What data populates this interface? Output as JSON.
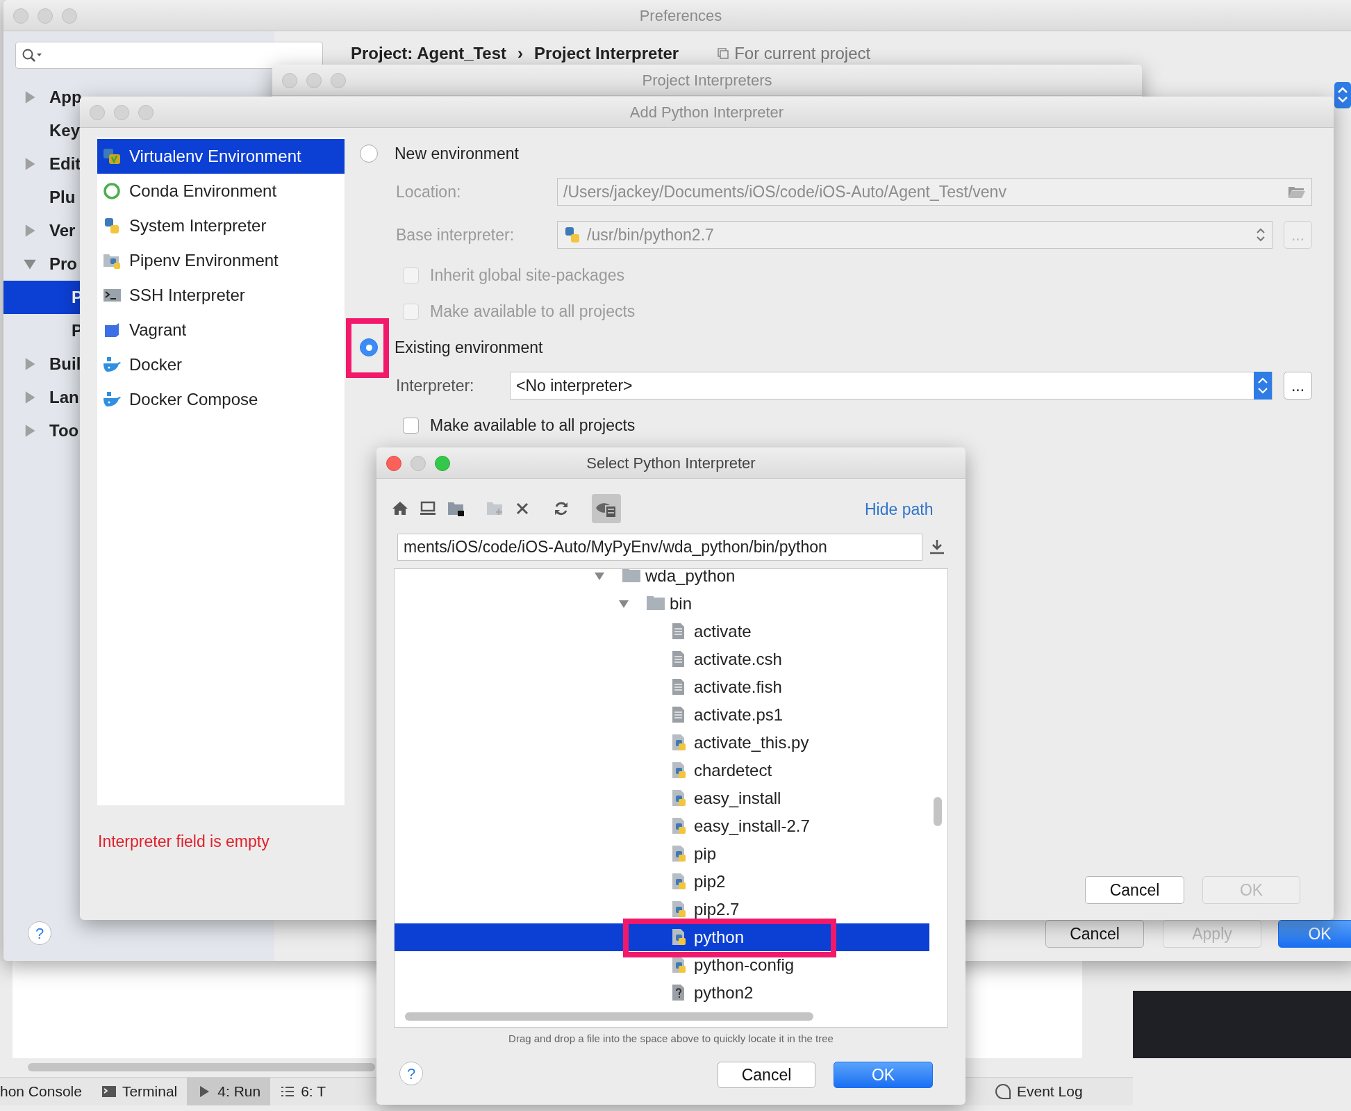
{
  "preferences": {
    "title": "Preferences",
    "sidebar": [
      {
        "label": "App",
        "expanded": false,
        "selected": false
      },
      {
        "label": "Key",
        "selected": false
      },
      {
        "label": "Edit",
        "expanded": false,
        "selected": false
      },
      {
        "label": "Plu",
        "selected": false
      },
      {
        "label": "Ver",
        "expanded": false,
        "selected": false
      },
      {
        "label": "Pro",
        "expanded": true,
        "selected": false,
        "children": [
          {
            "label": "P",
            "selected": true
          },
          {
            "label": "P",
            "selected": false
          }
        ]
      },
      {
        "label": "Buil",
        "expanded": false,
        "selected": false
      },
      {
        "label": "Lan",
        "expanded": false,
        "selected": false
      },
      {
        "label": "Too",
        "expanded": false,
        "selected": false
      }
    ],
    "breadcrumb": [
      "Project: Agent_Test",
      "Project Interpreter"
    ],
    "breadcrumb_separator": "›",
    "scope": "For current project",
    "help": "?",
    "buttons": [
      {
        "label": "Cancel",
        "kind": "default",
        "disabled": false
      },
      {
        "label": "Apply",
        "kind": "default",
        "disabled": true
      },
      {
        "label": "OK",
        "kind": "primary",
        "disabled": false
      }
    ]
  },
  "project_interpreters": {
    "title": "Project Interpreters"
  },
  "add_interpreter": {
    "title": "Add Python Interpreter",
    "types": [
      {
        "label": "Virtualenv Environment",
        "kind": "virtualenv",
        "selected": true
      },
      {
        "label": "Conda Environment",
        "kind": "conda",
        "selected": false
      },
      {
        "label": "System Interpreter",
        "kind": "system",
        "selected": false
      },
      {
        "label": "Pipenv Environment",
        "kind": "pipenv",
        "selected": false
      },
      {
        "label": "SSH Interpreter",
        "kind": "ssh",
        "selected": false
      },
      {
        "label": "Vagrant",
        "kind": "vagrant",
        "selected": false
      },
      {
        "label": "Docker",
        "kind": "docker",
        "selected": false
      },
      {
        "label": "Docker Compose",
        "kind": "docker",
        "selected": false
      }
    ],
    "new_env": {
      "label": "New environment",
      "selected": false,
      "disabled": true,
      "location_label": "Location:",
      "location": "/Users/jackey/Documents/iOS/code/iOS-Auto/Agent_Test/venv",
      "base_label": "Base interpreter:",
      "base": "/usr/bin/python2.7",
      "browse": "...",
      "checkboxes": [
        {
          "label": "Inherit global site-packages",
          "checked": false
        },
        {
          "label": "Make available to all projects",
          "checked": false
        }
      ]
    },
    "existing_env": {
      "label": "Existing environment",
      "selected": true,
      "disabled": false,
      "interpreter_label": "Interpreter:",
      "interpreter": "<No interpreter>",
      "browse": "...",
      "checkbox": {
        "label": "Make available to all projects",
        "checked": false
      }
    },
    "error": "Interpreter field is empty",
    "buttons": [
      {
        "label": "Cancel",
        "kind": "default",
        "disabled": false
      },
      {
        "label": "OK",
        "kind": "default",
        "disabled": true
      }
    ]
  },
  "select_dialog": {
    "title": "Select Python Interpreter",
    "hide_path": "Hide path",
    "path": "ments/iOS/code/iOS-Auto/MyPyEnv/wda_python/bin/python",
    "tree": [
      {
        "label": "wda_python",
        "kind": "folder",
        "expanded": true,
        "selected": false,
        "children": [
          {
            "label": "bin",
            "kind": "folder",
            "expanded": true,
            "selected": false,
            "children": [
              {
                "label": "activate",
                "kind": "text",
                "selected": false
              },
              {
                "label": "activate.csh",
                "kind": "text",
                "selected": false
              },
              {
                "label": "activate.fish",
                "kind": "text",
                "selected": false
              },
              {
                "label": "activate.ps1",
                "kind": "text",
                "selected": false
              },
              {
                "label": "activate_this.py",
                "kind": "python",
                "selected": false
              },
              {
                "label": "chardetect",
                "kind": "python",
                "selected": false
              },
              {
                "label": "easy_install",
                "kind": "python",
                "selected": false
              },
              {
                "label": "easy_install-2.7",
                "kind": "python",
                "selected": false
              },
              {
                "label": "pip",
                "kind": "python",
                "selected": false
              },
              {
                "label": "pip2",
                "kind": "python",
                "selected": false
              },
              {
                "label": "pip2.7",
                "kind": "python",
                "selected": false
              },
              {
                "label": "python",
                "kind": "python",
                "selected": true
              },
              {
                "label": "python-config",
                "kind": "python",
                "selected": false
              },
              {
                "label": "python2",
                "kind": "unknown",
                "selected": false
              }
            ]
          }
        ]
      }
    ],
    "hint": "Drag and drop a file into the space above to quickly locate it in the tree",
    "help": "?",
    "buttons": [
      {
        "label": "Cancel",
        "kind": "default",
        "disabled": false
      },
      {
        "label": "OK",
        "kind": "primary",
        "disabled": false
      }
    ]
  },
  "tool_windows": [
    {
      "label": "hon Console",
      "kind": "console",
      "selected": false
    },
    {
      "label": "Terminal",
      "kind": "terminal",
      "selected": false
    },
    {
      "label": "4: Run",
      "kind": "run",
      "selected": true
    },
    {
      "label": "6: T",
      "kind": "todo",
      "selected": false
    }
  ],
  "event_log": "Event Log"
}
